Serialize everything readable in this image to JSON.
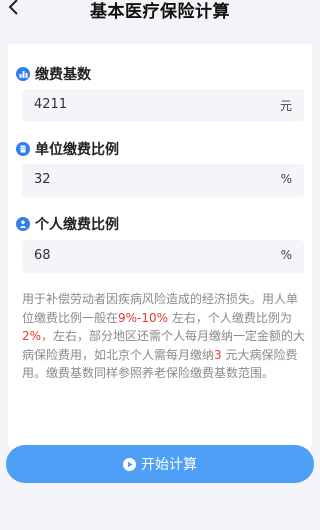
{
  "header": {
    "title": "基本医疗保险计算",
    "back_icon": "chevron-left-icon"
  },
  "fields": {
    "base": {
      "label": "缴费基数",
      "icon": "money-icon",
      "value": "4211",
      "unit": "元"
    },
    "employer": {
      "label": "单位缴费比例",
      "icon": "building-icon",
      "value": "32",
      "unit": "%"
    },
    "personal": {
      "label": "个人缴费比例",
      "icon": "person-icon",
      "value": "68",
      "unit": "%"
    }
  },
  "description": {
    "p1": "用于补偿劳动者因疾病风险造成的经济损失。用人单位缴费比例一般在",
    "h1": "9%-10%",
    "p2": " 左右，个人缴费比例为 ",
    "h2": "2%",
    "p3": "，左右，部分地区还需个人每月缴纳一定金额的大病保险费用，如北京个人需每月缴纳",
    "h3": "3",
    "p4": " 元大病保险费用。缴费基数同样参照养老保险缴费基数范围。"
  },
  "action": {
    "label": "开始计算",
    "icon": "play-circle-icon"
  },
  "colors": {
    "accent": "#2f7ff3",
    "button": "#4f9ff7",
    "highlight": "#e53935",
    "background": "#f3f4f7"
  }
}
